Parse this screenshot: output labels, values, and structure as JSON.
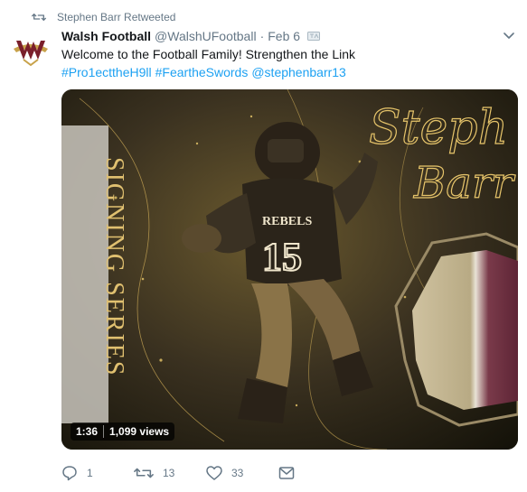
{
  "retweet_bar": {
    "text": "Stephen Barr Retweeted",
    "icon": "retweet-icon"
  },
  "tweet": {
    "author_name": "Walsh Football",
    "handle": "@WalshUFootball",
    "separator": "·",
    "date": "Feb 6",
    "text": "Welcome to the Football Family! Strengthen the Link",
    "hashtags": [
      "#Pro1ecttheH9ll",
      "#FeartheSwords",
      "@stephenbarr13"
    ]
  },
  "media": {
    "duration": "1:36",
    "views": "1,099 views",
    "card_vertical_text": "SIGNING SERIES",
    "jersey_team": "REBELS",
    "jersey_number": "15",
    "script_text_line1": "Steph",
    "script_text_line2": "Barr"
  },
  "actions": {
    "reply_count": "1",
    "retweet_count": "13",
    "like_count": "33"
  },
  "colors": {
    "link": "#1da1f2",
    "muted": "#657786",
    "logo_maroon": "#7a1f2b",
    "logo_gold": "#c8a24a"
  }
}
